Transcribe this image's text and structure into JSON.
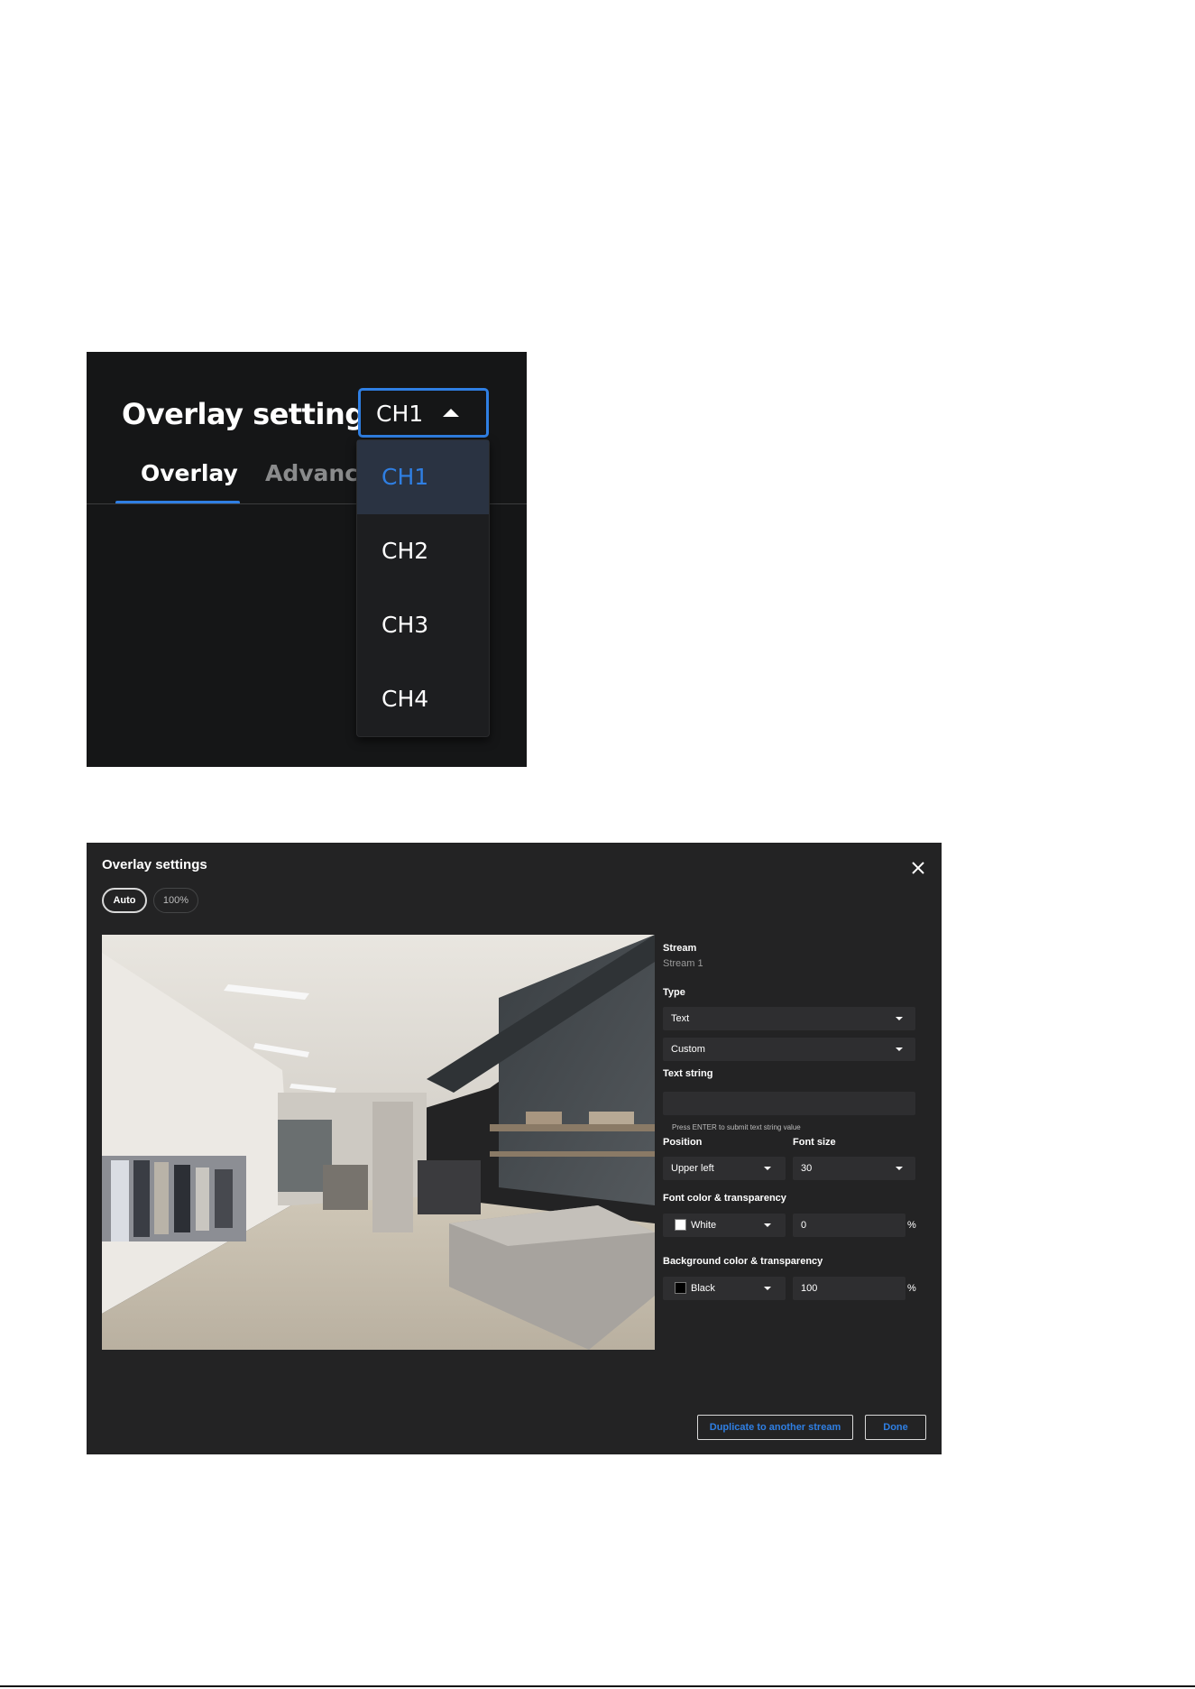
{
  "dropdown_panel": {
    "title": "Overlay settings",
    "channel_select": {
      "value": "CH1"
    },
    "tabs": [
      {
        "label": "Overlay",
        "active": true
      },
      {
        "label": "Advanced",
        "active": false
      }
    ],
    "menu_items": [
      {
        "label": "CH1",
        "selected": true
      },
      {
        "label": "CH2",
        "selected": false
      },
      {
        "label": "CH3",
        "selected": false
      },
      {
        "label": "CH4",
        "selected": false
      }
    ]
  },
  "dialog": {
    "title": "Overlay settings",
    "close_icon": "close-icon",
    "view_buttons": {
      "auto": "Auto",
      "zoom": "100%"
    },
    "stream": {
      "label": "Stream",
      "value": "Stream 1"
    },
    "type": {
      "label": "Type",
      "select1": "Text",
      "select2": "Custom"
    },
    "text_string": {
      "label": "Text string",
      "value": "",
      "hint": "Press ENTER to submit text string value"
    },
    "position": {
      "label": "Position",
      "value": "Upper left"
    },
    "font_size": {
      "label": "Font size",
      "value": "30"
    },
    "font_color": {
      "label": "Font color & transparency",
      "color_name": "White",
      "color": "#ffffff",
      "transparency": "0",
      "unit": "%"
    },
    "background_color": {
      "label": "Background color & transparency",
      "color_name": "Black",
      "color": "#000000",
      "transparency": "100",
      "unit": "%"
    },
    "buttons": {
      "duplicate": "Duplicate to another stream",
      "done": "Done"
    }
  },
  "colors": {
    "accent": "#2f7fe3",
    "panel_bg": "#151617",
    "dialog_bg": "#232324"
  }
}
